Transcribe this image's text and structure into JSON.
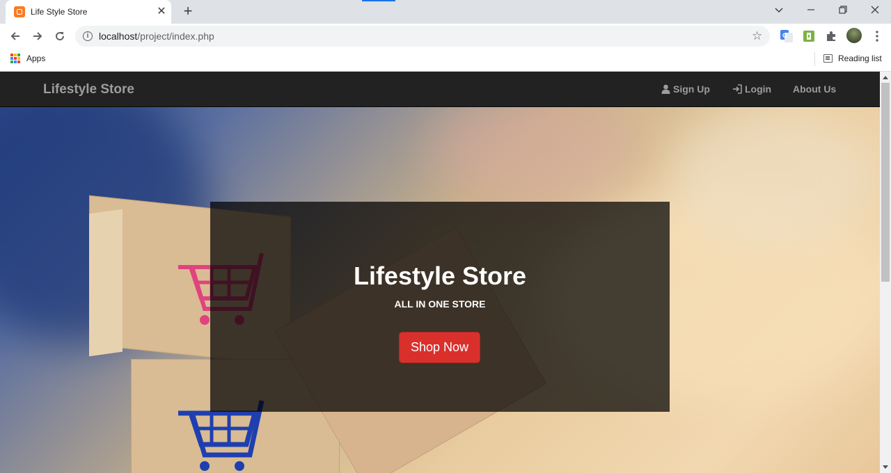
{
  "browser": {
    "tab_title": "Life Style Store",
    "url_host": "localhost",
    "url_path": "/project/index.php",
    "bookmarks": {
      "apps_label": "Apps",
      "reading_list_label": "Reading list"
    }
  },
  "navbar": {
    "brand": "Lifestyle Store",
    "links": [
      {
        "label": "Sign Up",
        "icon": "user-icon"
      },
      {
        "label": "Login",
        "icon": "login-icon"
      },
      {
        "label": "About Us",
        "icon": ""
      }
    ]
  },
  "hero": {
    "title": "Lifestyle Store",
    "subtitle": "ALL IN ONE STORE",
    "button_label": "Shop Now"
  },
  "colors": {
    "navbar_bg": "#222222",
    "nav_text": "#9d9d9d",
    "button_red": "#d9302c"
  }
}
